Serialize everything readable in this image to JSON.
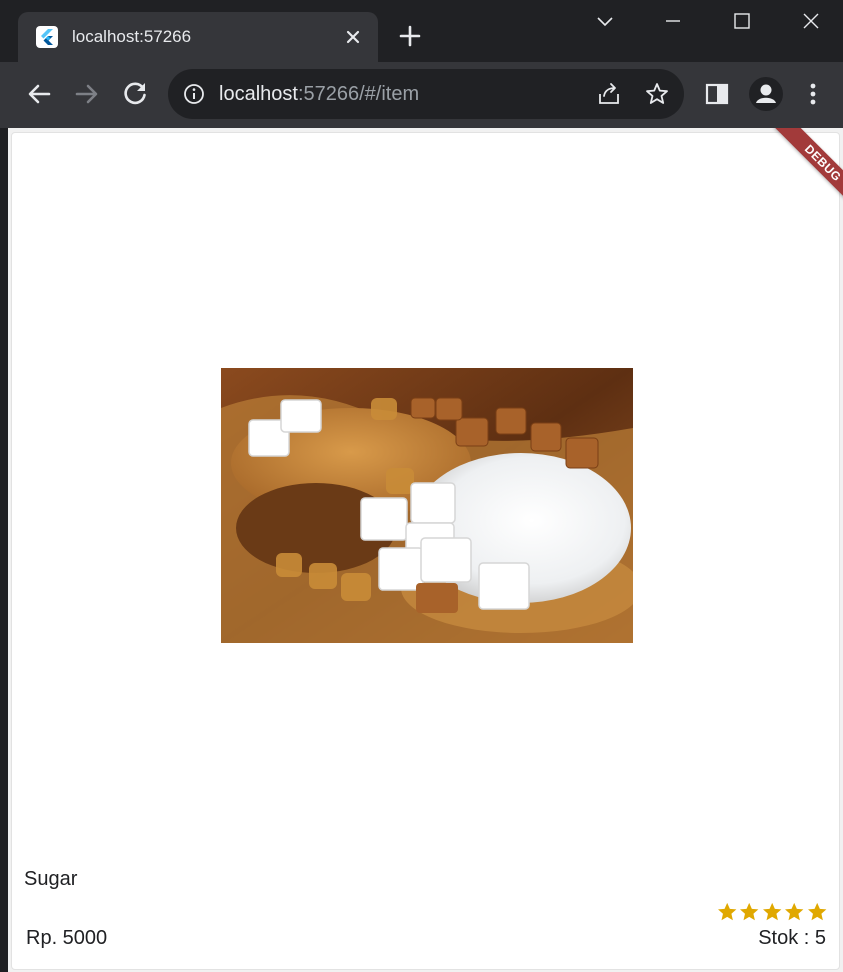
{
  "browser": {
    "tab_title": "localhost:57266",
    "url_host": "localhost",
    "url_rest": ":57266/#/item",
    "tab_favicon_icon": "flutter-logo-icon",
    "accent": "#8ab4f8"
  },
  "page": {
    "debug_label": "DEBUG",
    "product": {
      "name": "Sugar",
      "price": "Rp. 5000",
      "stock": "Stok : 5",
      "rating": 5,
      "rating_max": 5,
      "star_color": "#e0a800",
      "image_icon": "sugar-photo"
    }
  }
}
